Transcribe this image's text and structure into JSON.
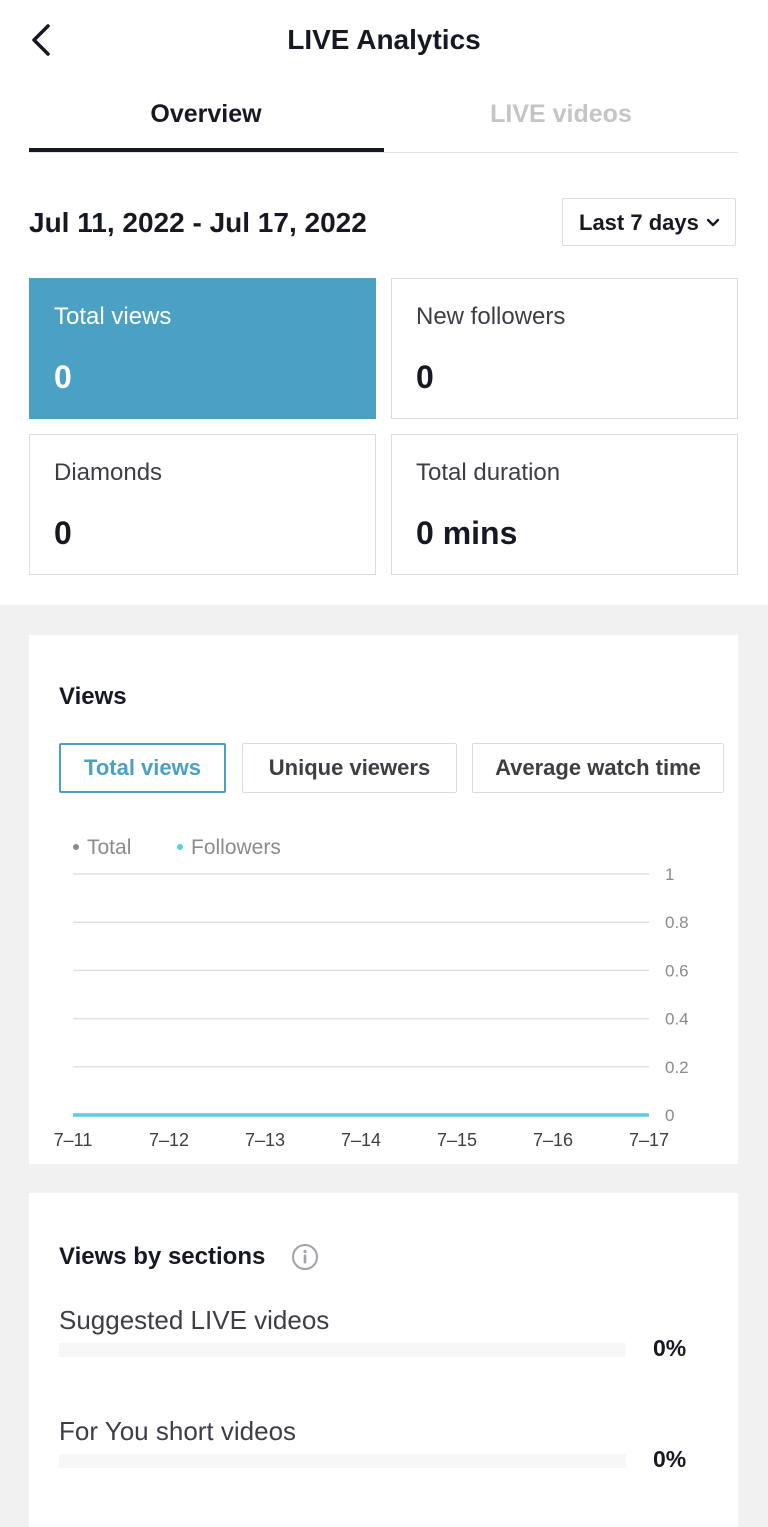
{
  "header": {
    "title": "LIVE Analytics"
  },
  "tabs": [
    {
      "label": "Overview",
      "active": true
    },
    {
      "label": "LIVE videos",
      "active": false
    }
  ],
  "date_range": {
    "text": "Jul 11, 2022 - Jul 17, 2022",
    "selector_label": "Last 7 days"
  },
  "stats": [
    {
      "label": "Total views",
      "value": "0",
      "active": true
    },
    {
      "label": "New followers",
      "value": "0",
      "active": false
    },
    {
      "label": "Diamonds",
      "value": "0",
      "active": false
    },
    {
      "label": "Total duration",
      "value": "0 mins",
      "active": false
    }
  ],
  "views_panel": {
    "title": "Views",
    "metric_buttons": [
      {
        "label": "Total views",
        "active": true
      },
      {
        "label": "Unique viewers",
        "active": false
      },
      {
        "label": "Average watch time",
        "active": false
      }
    ]
  },
  "chart_data": {
    "type": "line",
    "x": [
      "7–11",
      "7–12",
      "7–13",
      "7–14",
      "7–15",
      "7–16",
      "7–17"
    ],
    "series": [
      {
        "name": "Total",
        "values": [
          0,
          0,
          0,
          0,
          0,
          0,
          0
        ],
        "color": "#8a8b91"
      },
      {
        "name": "Followers",
        "values": [
          0,
          0,
          0,
          0,
          0,
          0,
          0
        ],
        "color": "#5ccbe6"
      }
    ],
    "ylim": [
      0,
      1
    ],
    "yticks": [
      "0",
      "0.2",
      "0.4",
      "0.6",
      "0.8",
      "1"
    ],
    "y_axis_side": "right",
    "grid": true,
    "legend_position": "top-left"
  },
  "sections_panel": {
    "title": "Views by sections",
    "info_icon": "info-circle-icon",
    "items": [
      {
        "label": "Suggested LIVE videos",
        "percent": "0%",
        "fraction": 0
      },
      {
        "label": "For You short videos",
        "percent": "0%",
        "fraction": 0
      }
    ]
  },
  "colors": {
    "accent": "#4aa1c3",
    "followers_line": "#5ccbe6",
    "text_primary": "#161823",
    "text_muted": "#c4c5c8",
    "background": "#f1f1f2"
  }
}
